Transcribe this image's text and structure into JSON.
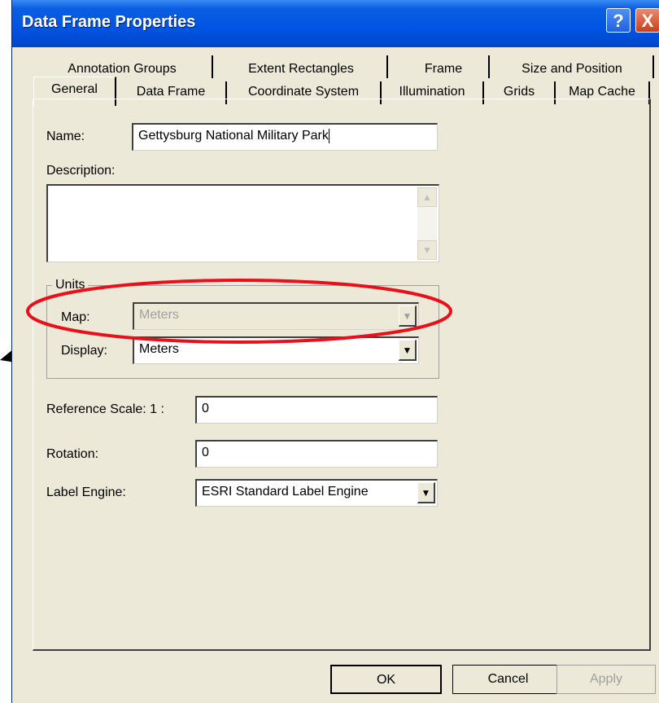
{
  "window": {
    "title": "Data Frame Properties",
    "help_glyph": "?",
    "close_glyph": "X"
  },
  "tabs_row_back": [
    "Annotation Groups",
    "Extent Rectangles",
    "Frame",
    "Size and Position"
  ],
  "tabs_row_front": [
    "General",
    "Data Frame",
    "Coordinate System",
    "Illumination",
    "Grids",
    "Map Cache"
  ],
  "active_tab": "General",
  "general": {
    "name_label": "Name:",
    "name_value": "Gettysburg National Military Park",
    "description_label": "Description:",
    "description_value": "",
    "units_group_label": "Units",
    "map_label": "Map:",
    "map_value": "Meters",
    "display_label": "Display:",
    "display_value": "Meters",
    "ref_scale_label": "Reference Scale:  1 :",
    "ref_scale_value": "0",
    "rotation_label": "Rotation:",
    "rotation_value": "0",
    "label_engine_label": "Label Engine:",
    "label_engine_value": "ESRI Standard Label Engine"
  },
  "buttons": {
    "ok": "OK",
    "cancel": "Cancel",
    "apply": "Apply"
  },
  "annotation": {
    "highlight_color": "#e8101a",
    "arrow_color": "#000000"
  },
  "icons": {
    "dropdown": "chevron-down-icon",
    "scroll_up": "scroll-up-icon",
    "scroll_down": "scroll-down-icon"
  }
}
